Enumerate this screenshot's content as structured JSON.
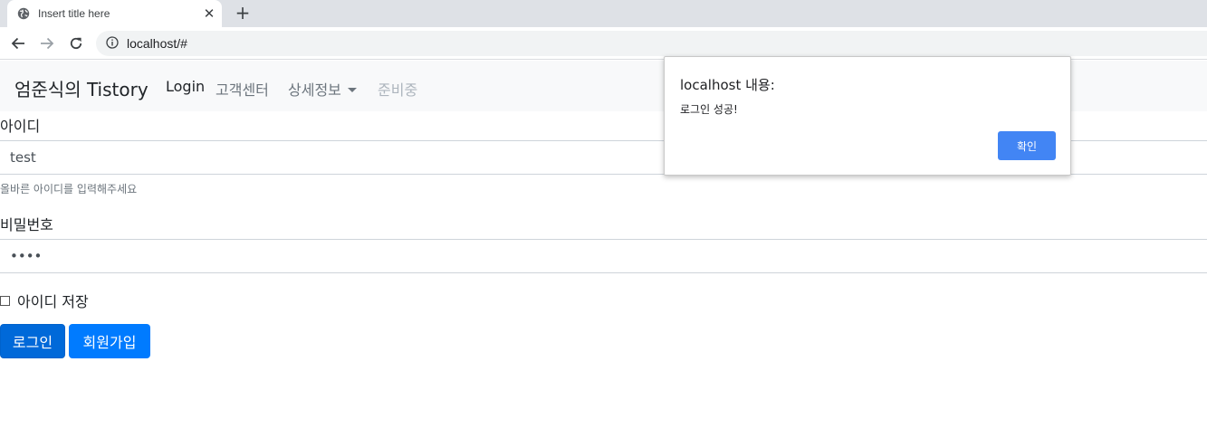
{
  "browser": {
    "tab_title": "Insert title here",
    "tab_close": "✕",
    "new_tab": "+",
    "url": "localhost/#",
    "icons": [
      "globe-icon",
      "close-icon",
      "plus-icon",
      "back-arrow-icon",
      "forward-arrow-icon",
      "reload-icon",
      "info-icon"
    ]
  },
  "navbar": {
    "brand": "엄준식의 Tistory",
    "links": [
      {
        "label": "Login",
        "state": "active"
      },
      {
        "label": "고객센터",
        "state": "normal"
      },
      {
        "label": "상세정보",
        "state": "dropdown"
      },
      {
        "label": "준비중",
        "state": "disabled"
      }
    ]
  },
  "form": {
    "id_label": "아이디",
    "id_value": "test",
    "id_help": "올바른 아이디를 입력해주세요",
    "pw_label": "비밀번호",
    "pw_value": "••••",
    "remember_label": "아이디 저장",
    "remember_checked": false,
    "login_button": "로그인",
    "signup_button": "회원가입"
  },
  "alert": {
    "title": "localhost 내용:",
    "message": "로그인 성공!",
    "ok_button": "확인"
  },
  "colors": {
    "primary": "#007bff",
    "primary_active": "#0069d9",
    "dialog_button": "#4285f4",
    "navbar_bg": "#f8f9fa"
  }
}
